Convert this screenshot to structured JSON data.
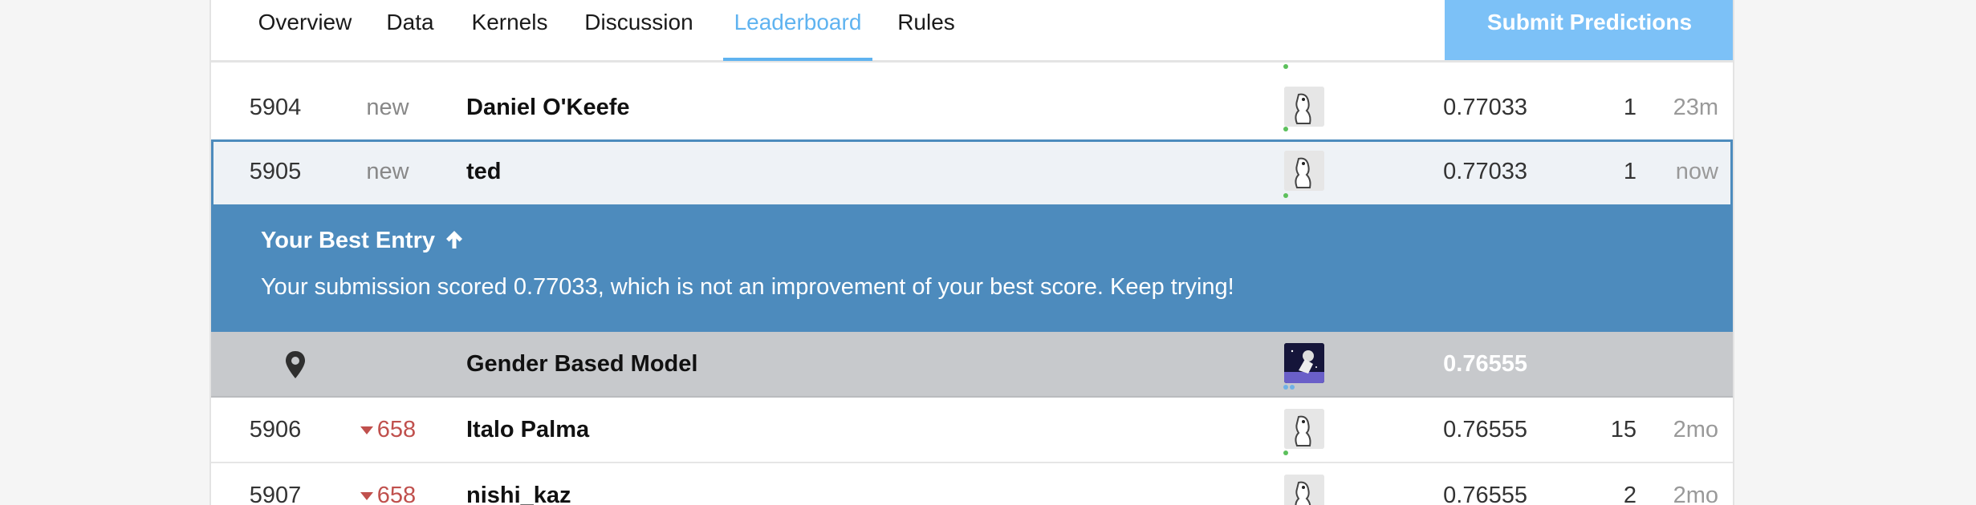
{
  "tabs": [
    {
      "label": "Overview"
    },
    {
      "label": "Data"
    },
    {
      "label": "Kernels"
    },
    {
      "label": "Discussion"
    },
    {
      "label": "Leaderboard"
    },
    {
      "label": "Rules"
    }
  ],
  "active_tab": "Leaderboard",
  "submit_button": "Submit Predictions",
  "rows": [
    {
      "rank": "5904",
      "delta": "new",
      "name": "Daniel O'Keefe",
      "score": "0.77033",
      "entries": "1",
      "last": "23m"
    },
    {
      "rank": "5905",
      "delta": "new",
      "name": "ted",
      "score": "0.77033",
      "entries": "1",
      "last": "now"
    },
    {
      "rank": "5906",
      "delta": "658",
      "name": "Italo Palma",
      "score": "0.76555",
      "entries": "15",
      "last": "2mo"
    },
    {
      "rank": "5907",
      "delta": "658",
      "name": "nishi_kaz",
      "score": "0.76555",
      "entries": "2",
      "last": "2mo"
    }
  ],
  "best_entry": {
    "title": "Your Best Entry",
    "message": "Your submission scored 0.77033, which is not an improvement of your best score. Keep trying!"
  },
  "benchmark": {
    "name": "Gender Based Model",
    "score": "0.76555"
  },
  "colors": {
    "accent": "#5fb3f0",
    "submit_bg": "#7cc1f7",
    "best_entry_bg": "#4d8bbd",
    "benchmark_bg": "#c7c9cc",
    "rank_down": "#c0504d",
    "online_dot": "#5cc05c"
  },
  "icons": {
    "best_entry_arrow": "arrow-up-icon",
    "benchmark": "map-pin-icon",
    "rank_change": "caret-down-icon"
  }
}
